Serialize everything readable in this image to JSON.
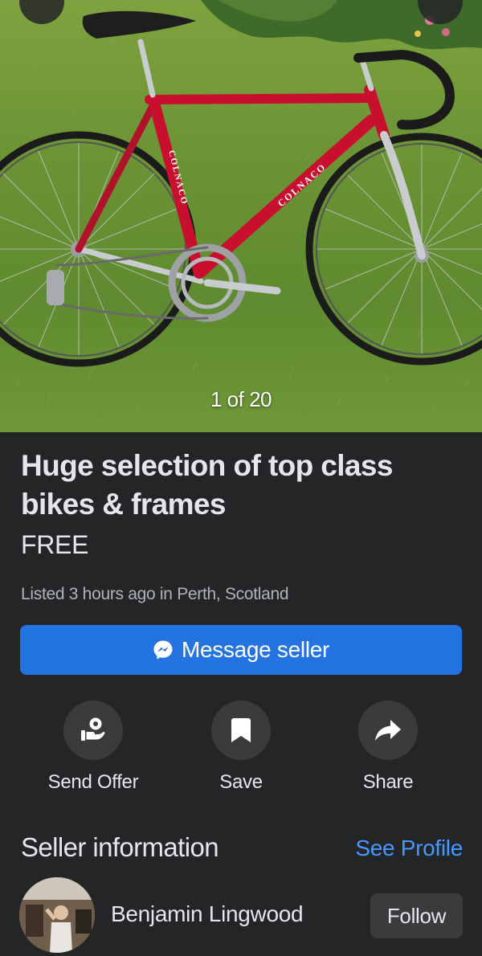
{
  "photo": {
    "counter": "1 of 20",
    "frame_lettering": "COLNACO",
    "frame_color": "#c8102e"
  },
  "listing": {
    "title": "Huge selection of top class bikes & frames",
    "price": "FREE",
    "meta": "Listed 3 hours ago in Perth, Scotland"
  },
  "message_button": {
    "label": "Message seller",
    "icon": "messenger-icon",
    "color": "#2374e1"
  },
  "actions": [
    {
      "label": "Send Offer",
      "icon": "send-offer-icon"
    },
    {
      "label": "Save",
      "icon": "bookmark-icon"
    },
    {
      "label": "Share",
      "icon": "share-arrow-icon"
    }
  ],
  "seller": {
    "heading": "Seller information",
    "see_profile": "See Profile",
    "name": "Benjamin Lingwood",
    "follow": "Follow",
    "link_color": "#4599ff"
  }
}
